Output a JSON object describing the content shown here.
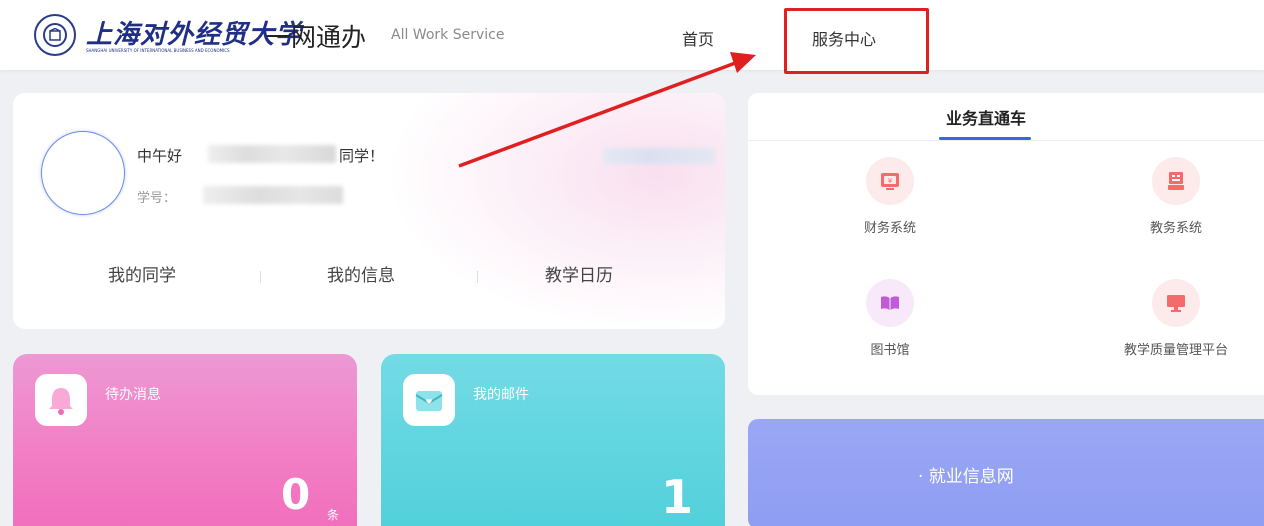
{
  "header": {
    "logo_text": "上海对外经贸大学",
    "logo_en": "SHANGHAI UNIVERSITY OF INTERNATIONAL BUSINESS AND ECONOMICS",
    "app_title": "一网通办",
    "app_subtitle": "All Work Service",
    "nav": {
      "home": "首页",
      "service_center": "服务中心"
    }
  },
  "profile": {
    "greeting_prefix": "中午好",
    "greeting_suffix": "同学！",
    "student_id_label": "学号：",
    "links": [
      "我的同学",
      "我的信息",
      "教学日历"
    ]
  },
  "todo": {
    "title": "待办消息",
    "count": "0",
    "unit": "条"
  },
  "mail": {
    "title": "我的邮件",
    "count": "1"
  },
  "quick_access": {
    "title": "业务直通车",
    "items": [
      {
        "label": "财务系统",
        "icon": "finance-icon"
      },
      {
        "label": "教务系统",
        "icon": "academic-icon"
      },
      {
        "label": "图书馆",
        "icon": "library-icon"
      },
      {
        "label": "教学质量管理平台",
        "icon": "quality-icon"
      }
    ]
  },
  "employment": {
    "label": "· 就业信息网"
  },
  "colors": {
    "accent_blue": "#3b66e3",
    "highlight_red": "#e02020",
    "todo_pink": "#f27bc2",
    "mail_teal": "#4fcfda",
    "job_purple": "#9aa7f5"
  }
}
